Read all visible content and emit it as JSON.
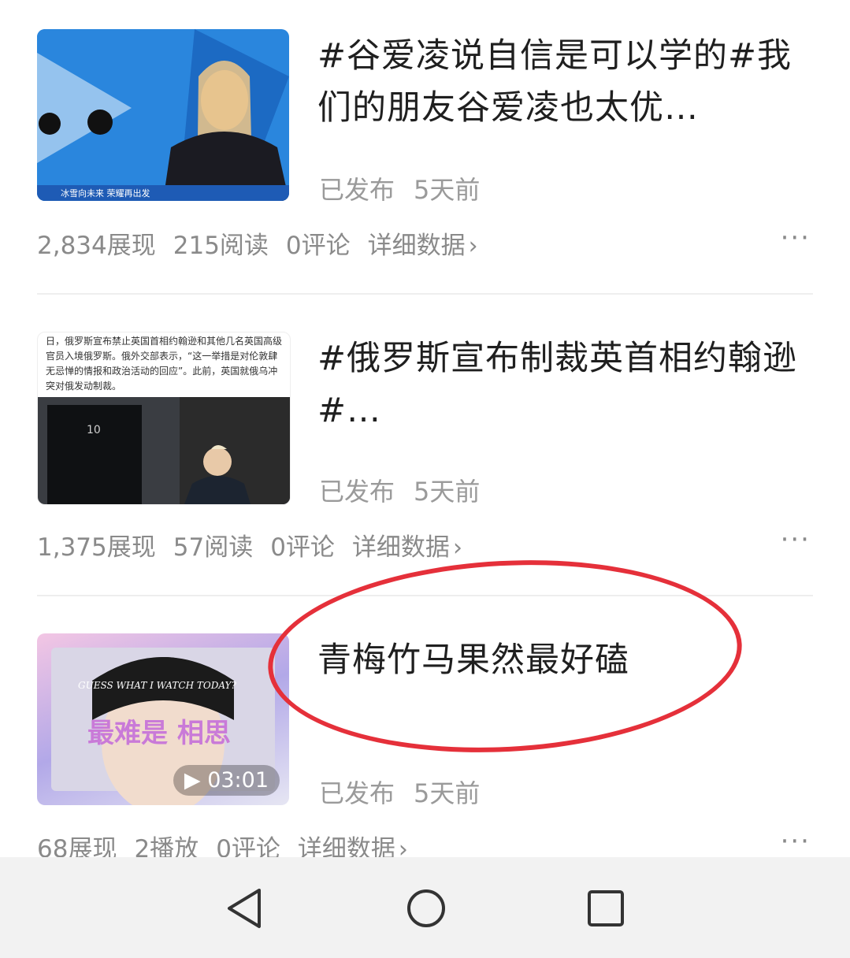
{
  "items": [
    {
      "title": "#谷爱凌说自信是可以学的#我们的朋友谷爱凌也太优…",
      "status": "已发布",
      "time": "5天前",
      "stats": [
        "2,834展现",
        "215阅读",
        "0评论"
      ],
      "detail_label": "详细数据",
      "thumb_caption": "冰雪向未来 荣耀再出发"
    },
    {
      "title": "#俄罗斯宣布制裁英首相约翰逊#…",
      "status": "已发布",
      "time": "5天前",
      "stats": [
        "1,375展现",
        "57阅读",
        "0评论"
      ],
      "detail_label": "详细数据",
      "thumb_text": "日，俄罗斯宣布禁止英国首相约翰逊和其他几名英国高级官员入境俄罗斯。俄外交部表示，“这一举措是对伦敦肆无忌惮的情报和政治活动的回应”。此前，英国就俄乌冲突对俄发动制裁。"
    },
    {
      "title": "青梅竹马果然最好磕",
      "status": "已发布",
      "time": "5天前",
      "stats": [
        "68展现",
        "2播放",
        "0评论"
      ],
      "detail_label": "详细数据",
      "thumb_overlay_top": "GUESS WHAT I WATCH TODAY?",
      "thumb_overlay_main": "最难是 相思",
      "duration": "03:01"
    }
  ],
  "more_label": "···",
  "chevron": "›",
  "colors": {
    "annotation": "#e5303a",
    "text_secondary": "#9a9a9a"
  },
  "nav": {
    "back_icon": "back-triangle-icon",
    "home_icon": "home-circle-icon",
    "recent_icon": "recent-square-icon"
  }
}
